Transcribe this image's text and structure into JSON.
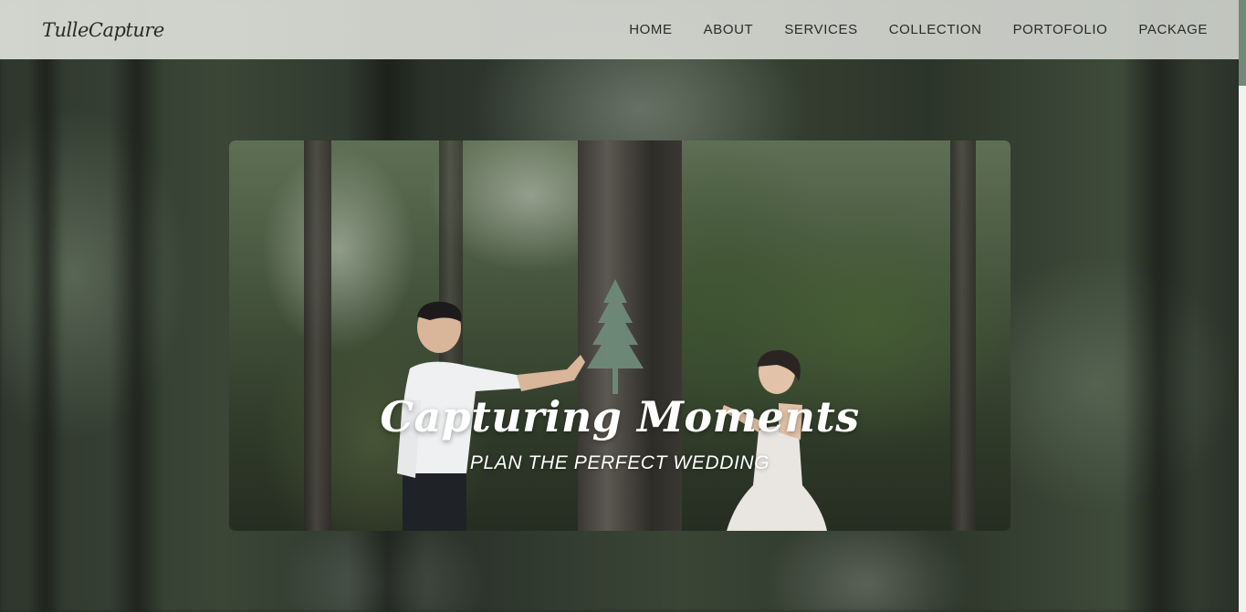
{
  "header": {
    "logo": "TulleCapture",
    "nav": [
      "HOME",
      "ABOUT",
      "SERVICES",
      "COLLECTION",
      "PORTOFOLIO",
      "PACKAGE"
    ]
  },
  "hero": {
    "title": "Capturing Moments",
    "subtitle": "PLAN THE PERFECT WEDDING",
    "icon": "pine-tree-icon"
  },
  "colors": {
    "accent": "#6f8a78",
    "header_bg": "#d8dad4",
    "text_dark": "#2a2a2a"
  }
}
